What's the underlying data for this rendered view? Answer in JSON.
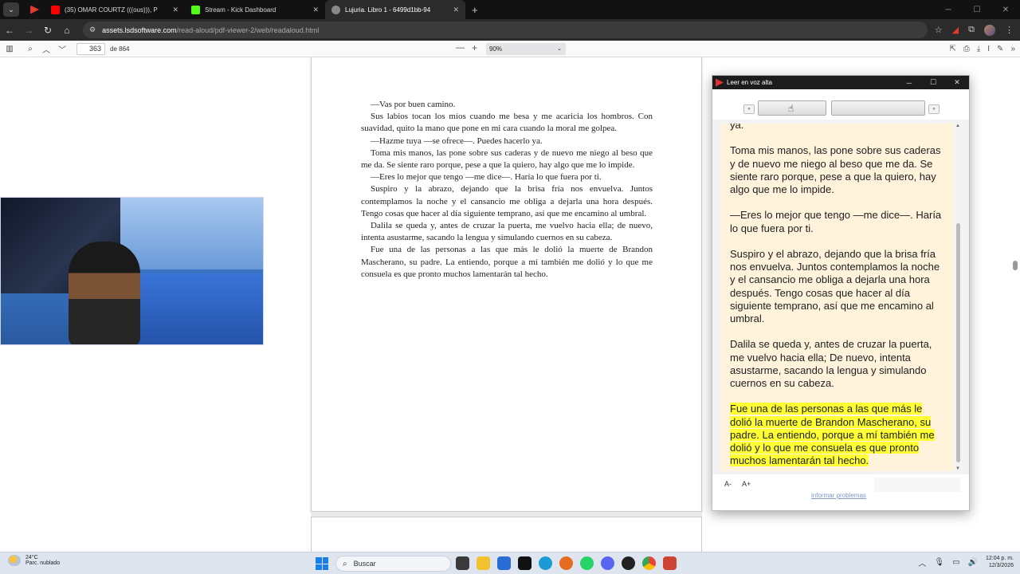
{
  "browser": {
    "tabs": [
      {
        "title": "",
        "favicon_color": "#e23b2e"
      },
      {
        "title": "(35) OMAR COURTZ (((ous))), P",
        "favicon_color": "#ff0000"
      },
      {
        "title": "Stream - Kick Dashboard",
        "favicon_color": "#53fc18"
      },
      {
        "title": "Lujuria. Libro 1 - 6499d1bb-94",
        "favicon_color": "#888888",
        "active": true
      }
    ],
    "address": {
      "host": "assets.lsdsoftware.com",
      "path": "/read-aloud/pdf-viewer-2/web/readaloud.html"
    }
  },
  "pdf_viewer": {
    "page_number": "363",
    "page_count": "de 864",
    "zoom": "90%",
    "paragraphs": [
      "—Vas por buen camino.",
      "Sus labios tocan los míos cuando me besa y me acaricia los hombros. Con suavidad, quito la mano que pone en mi cara cuando la moral me golpea.",
      "—Hazme tuya —se ofrece—. Puedes hacerlo ya.",
      "Toma mis manos, las pone sobre sus caderas y de nuevo me niego al beso que me da. Se siente raro porque, pese a que la quiero, hay algo que me lo impide.",
      "—Eres lo mejor que tengo —me dice—. Haría lo que fuera por ti.",
      "Suspiro y la abrazo, dejando que la brisa fría nos envuelva. Juntos contemplamos la noche y el cansancio me obliga a dejarla una hora después. Tengo cosas que hacer al día siguiente temprano, así que me encamino al umbral.",
      "Dalila se queda y, antes de cruzar la puerta, me vuelvo hacia ella; de nuevo, intenta asustarme, sacando la lengua y simulando cuernos en su cabeza.",
      "Fue una de las personas a las que más le dolió la muerte de Brandon Mascherano, su padre. La entiendo, porque a mí también me dolió y lo que me consuela es que pronto muchos lamentarán tal hecho."
    ]
  },
  "read_aloud": {
    "title": "Leer en voz alta",
    "prev_label": "«",
    "next_label": "»",
    "paragraphs": [
      "ya.",
      "Toma mis manos, las pone sobre sus caderas y de nuevo me niego al beso que me da. Se siente raro porque, pese a que la quiero, hay algo que me lo impide.",
      "—Eres lo mejor que tengo —me dice—. Haría lo que fuera por ti.",
      "Suspiro y el abrazo, dejando que la brisa fría nos envuelva. Juntos contemplamos la noche y el cansancio me obliga a dejarla una hora después. Tengo cosas que hacer al día siguiente temprano, así que me encamino al umbral.",
      "Dalila se queda y, antes de cruzar la puerta, me vuelvo hacia ella; De nuevo, intenta asustarme, sacando la lengua y simulando cuernos en su cabeza."
    ],
    "highlighted": "Fue una de las personas a las que más le dolió la muerte de Brandon Mascherano, su padre. La entiendo, porque a mí también me dolió y lo que me consuela es que pronto muchos lamentarán tal hecho.",
    "font_decrease": "A-",
    "font_increase": "A+",
    "report_link": "informar problemas",
    "highlight_color": "#ffff33",
    "background_color": "#fff3dc"
  },
  "taskbar": {
    "weather_temp": "24°C",
    "weather_desc": "Parc. nublado",
    "search_placeholder": "Buscar",
    "time": "12:04 p. m.",
    "date": "12/3/2026"
  }
}
